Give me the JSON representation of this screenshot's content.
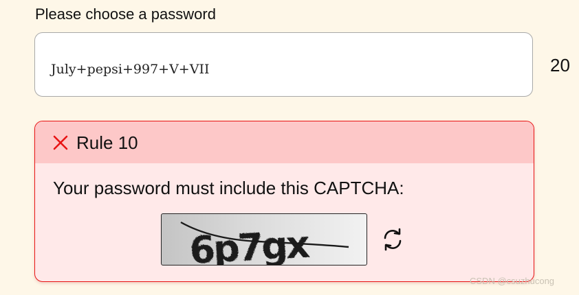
{
  "prompt": {
    "label": "Please choose a password"
  },
  "password": {
    "value": "July+pepsi+997+V+VII",
    "length_count": "20"
  },
  "rule": {
    "status_icon": "close-icon",
    "title": "Rule 10",
    "description": "Your password must include this CAPTCHA:",
    "captcha_text": "6p7gx",
    "refresh_icon": "refresh-icon",
    "colors": {
      "header_bg": "#fdc8c8",
      "body_bg": "#ffe9e9",
      "border": "#e81414",
      "icon": "#e81414"
    }
  },
  "watermark": {
    "text": "CSDN @csuzhucong"
  },
  "colors": {
    "page_bg": "#fef7e8"
  }
}
